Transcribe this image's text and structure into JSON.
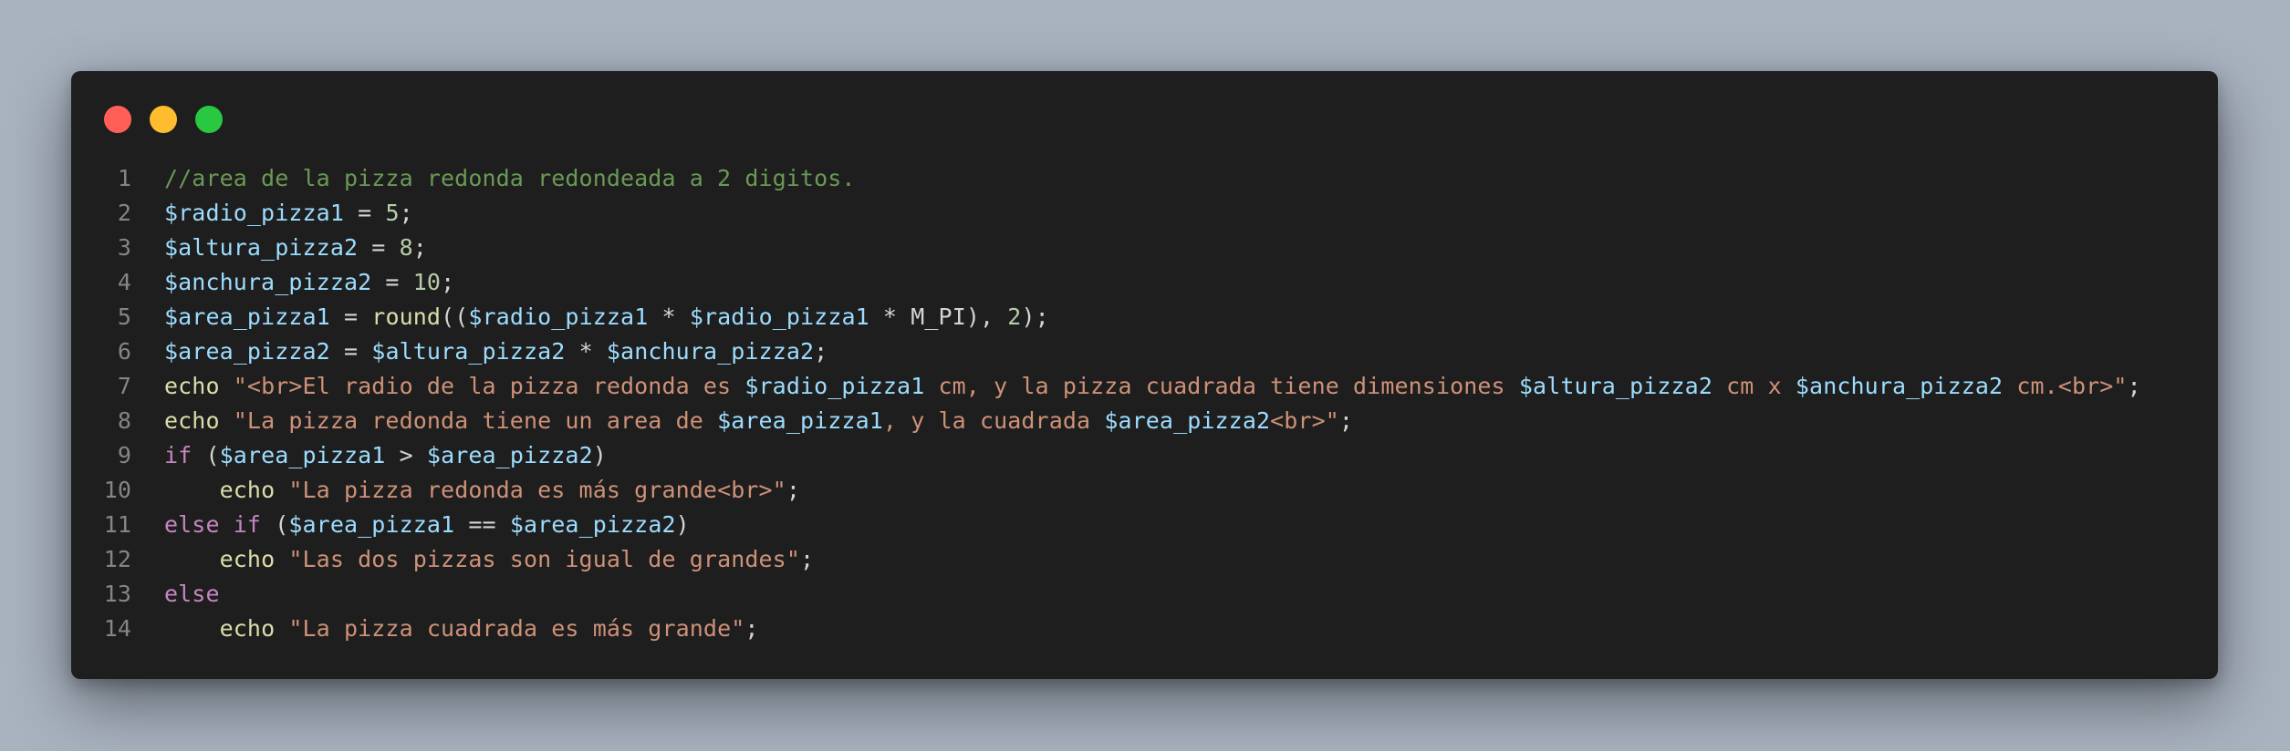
{
  "window": {
    "controls": [
      "close",
      "minimize",
      "zoom"
    ],
    "colors": {
      "close": "#ff5f57",
      "minimize": "#febc2e",
      "zoom": "#28c840",
      "background": "#1e1e1e"
    }
  },
  "code": {
    "language": "php",
    "lines": [
      {
        "num": "1",
        "tokens": [
          [
            "c",
            "//area de la pizza redonda redondeada a 2 digitos."
          ]
        ]
      },
      {
        "num": "2",
        "tokens": [
          [
            "v",
            "$radio_pizza1"
          ],
          [
            "p",
            " = "
          ],
          [
            "n",
            "5"
          ],
          [
            "p",
            ";"
          ]
        ]
      },
      {
        "num": "3",
        "tokens": [
          [
            "v",
            "$altura_pizza2"
          ],
          [
            "p",
            " = "
          ],
          [
            "n",
            "8"
          ],
          [
            "p",
            ";"
          ]
        ]
      },
      {
        "num": "4",
        "tokens": [
          [
            "v",
            "$anchura_pizza2"
          ],
          [
            "p",
            " = "
          ],
          [
            "n",
            "10"
          ],
          [
            "p",
            ";"
          ]
        ]
      },
      {
        "num": "5",
        "tokens": [
          [
            "v",
            "$area_pizza1"
          ],
          [
            "p",
            " = "
          ],
          [
            "f",
            "round"
          ],
          [
            "p",
            "(("
          ],
          [
            "v",
            "$radio_pizza1"
          ],
          [
            "p",
            " * "
          ],
          [
            "v",
            "$radio_pizza1"
          ],
          [
            "p",
            " * M_PI), "
          ],
          [
            "n",
            "2"
          ],
          [
            "p",
            ");"
          ]
        ]
      },
      {
        "num": "6",
        "tokens": [
          [
            "v",
            "$area_pizza2"
          ],
          [
            "p",
            " = "
          ],
          [
            "v",
            "$altura_pizza2"
          ],
          [
            "p",
            " * "
          ],
          [
            "v",
            "$anchura_pizza2"
          ],
          [
            "p",
            ";"
          ]
        ]
      },
      {
        "num": "7",
        "tokens": [
          [
            "f",
            "echo"
          ],
          [
            "p",
            " "
          ],
          [
            "s",
            "\"<br>El radio de la pizza redonda es "
          ],
          [
            "v",
            "$radio_pizza1"
          ],
          [
            "s",
            " cm, y la pizza cuadrada tiene dimensiones "
          ],
          [
            "v",
            "$altura_pizza2"
          ],
          [
            "s",
            " cm x "
          ],
          [
            "v",
            "$anchura_pizza2"
          ],
          [
            "s",
            " cm.<br>\""
          ],
          [
            "p",
            ";"
          ]
        ]
      },
      {
        "num": "8",
        "tokens": [
          [
            "f",
            "echo"
          ],
          [
            "p",
            " "
          ],
          [
            "s",
            "\"La pizza redonda tiene un area de "
          ],
          [
            "v",
            "$area_pizza1"
          ],
          [
            "s",
            ", y la cuadrada "
          ],
          [
            "v",
            "$area_pizza2"
          ],
          [
            "s",
            "<br>\""
          ],
          [
            "p",
            ";"
          ]
        ]
      },
      {
        "num": "9",
        "tokens": [
          [
            "k",
            "if"
          ],
          [
            "p",
            " ("
          ],
          [
            "v",
            "$area_pizza1"
          ],
          [
            "p",
            " > "
          ],
          [
            "v",
            "$area_pizza2"
          ],
          [
            "p",
            ")"
          ]
        ]
      },
      {
        "num": "10",
        "tokens": [
          [
            "p",
            "    "
          ],
          [
            "f",
            "echo"
          ],
          [
            "p",
            " "
          ],
          [
            "s",
            "\"La pizza redonda es más grande<br>\""
          ],
          [
            "p",
            ";"
          ]
        ]
      },
      {
        "num": "11",
        "tokens": [
          [
            "k",
            "else if"
          ],
          [
            "p",
            " ("
          ],
          [
            "v",
            "$area_pizza1"
          ],
          [
            "p",
            " == "
          ],
          [
            "v",
            "$area_pizza2"
          ],
          [
            "p",
            ")"
          ]
        ]
      },
      {
        "num": "12",
        "tokens": [
          [
            "p",
            "    "
          ],
          [
            "f",
            "echo"
          ],
          [
            "p",
            " "
          ],
          [
            "s",
            "\"Las dos pizzas son igual de grandes\""
          ],
          [
            "p",
            ";"
          ]
        ]
      },
      {
        "num": "13",
        "tokens": [
          [
            "k",
            "else"
          ]
        ]
      },
      {
        "num": "14",
        "tokens": [
          [
            "p",
            "    "
          ],
          [
            "f",
            "echo"
          ],
          [
            "p",
            " "
          ],
          [
            "s",
            "\"La pizza cuadrada es más grande\""
          ],
          [
            "p",
            ";"
          ]
        ]
      }
    ]
  }
}
